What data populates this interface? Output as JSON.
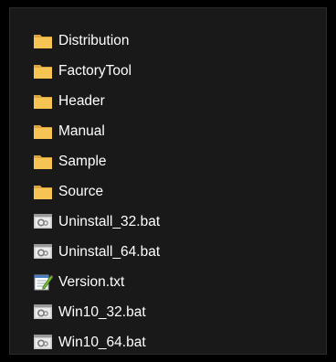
{
  "files": [
    {
      "name": "Distribution",
      "icon": "folder-icon"
    },
    {
      "name": "FactoryTool",
      "icon": "folder-icon"
    },
    {
      "name": "Header",
      "icon": "folder-icon"
    },
    {
      "name": "Manual",
      "icon": "folder-icon"
    },
    {
      "name": "Sample",
      "icon": "folder-icon"
    },
    {
      "name": "Source",
      "icon": "folder-icon"
    },
    {
      "name": "Uninstall_32.bat",
      "icon": "batch-file-icon"
    },
    {
      "name": "Uninstall_64.bat",
      "icon": "batch-file-icon"
    },
    {
      "name": "Version.txt",
      "icon": "text-file-icon"
    },
    {
      "name": "Win10_32.bat",
      "icon": "batch-file-icon"
    },
    {
      "name": "Win10_64.bat",
      "icon": "batch-file-icon"
    }
  ],
  "colors": {
    "background": "#191919",
    "text": "#ffffff",
    "folder": "#f5c453"
  }
}
